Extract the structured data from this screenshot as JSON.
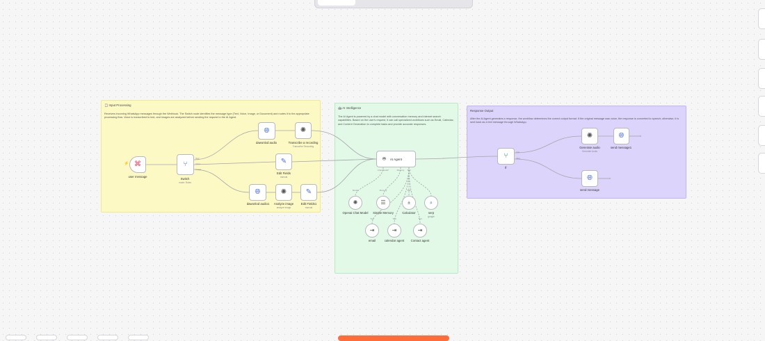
{
  "stickies": {
    "input": {
      "title": "📋 Input Processing",
      "body": "Receives incoming WhatsApp messages through the Webhook. The Switch node identifies the message type (Text, Voice, Image, or Document) and routes it to the appropriate processing flow. Voice is transcribed to text, and Images are analyzed before sending the request to the AI Agent."
    },
    "ai": {
      "title": "🤖 AI Intelligence",
      "body": "The AI Agent is powered by a chat model with conversation memory and internet search capabilities. Based on the user's request, it can call specialized workflows such as Email, Calendar, and Content Generation to complete tasks and provide accurate responses."
    },
    "output": {
      "title": "Response Output",
      "body": "After the AI Agent generates a response, the workflow determines the correct output format. If the original message was voice, the response is converted to speech; otherwise, it is sent back as a text message through WhatsApp."
    }
  },
  "nodes": {
    "user_message": {
      "label": "user message",
      "icon": "webhook-icon"
    },
    "switch": {
      "label": "Switch",
      "sub": "mode: Rules",
      "icon": "switch-icon",
      "outputs": [
        "Text",
        "Voice",
        "Image"
      ]
    },
    "download_audio": {
      "label": "dawonlod audio",
      "icon": "globe-icon"
    },
    "transcribe": {
      "label": "Transcribe a recording",
      "sub": "Transcribe Recording",
      "icon": "openai-icon"
    },
    "edit_fields": {
      "label": "Edit Fields",
      "sub": "manual",
      "icon": "pencil-icon"
    },
    "download_audio2": {
      "label": "dawonlod audio1",
      "icon": "globe-icon"
    },
    "analyze_image": {
      "label": "Analyze image",
      "sub": "analyze image",
      "icon": "openai-icon"
    },
    "edit_fields1": {
      "label": "Edit Fields1",
      "sub": "manual",
      "icon": "pencil-icon"
    },
    "ai_agent": {
      "label": "AI Agent",
      "icon": "robot-icon",
      "ports": [
        "Chat Model*",
        "Memory",
        "Tool"
      ]
    },
    "openai_chat": {
      "label": "Openai Chat Model",
      "icon": "openai-icon",
      "port": "Model"
    },
    "simple_memory": {
      "label": "Simple Memory",
      "icon": "database-icon",
      "port": "Memory"
    },
    "calculator": {
      "label": "Calculator",
      "icon": "calculator-icon",
      "port": "Tool"
    },
    "serp": {
      "label": "serp",
      "sub": "google",
      "icon": "serp-icon"
    },
    "email": {
      "label": "email",
      "icon": "subworkflow-icon",
      "port": "Tool"
    },
    "calendar": {
      "label": "calendar agent",
      "icon": "subworkflow-icon",
      "port": "Tool"
    },
    "contact": {
      "label": "Contact agent",
      "icon": "subworkflow-icon",
      "port": "Tool"
    },
    "if": {
      "label": "If",
      "icon": "if-icon",
      "outputs": [
        "true",
        "false"
      ]
    },
    "generate_audio": {
      "label": "Generate audio",
      "sub": "Generate Audio",
      "icon": "openai-icon"
    },
    "send_message1": {
      "label": "send message1",
      "icon": "globe-icon"
    },
    "send_message": {
      "label": "send message",
      "icon": "globe-icon"
    }
  },
  "colors": {
    "yellow_sticky": "#fdf9c4",
    "green_sticky": "#e3f9e7",
    "purple_sticky": "#ddd4fb",
    "accent": "#ff6d3a",
    "trigger_icon": "#e0405b"
  }
}
